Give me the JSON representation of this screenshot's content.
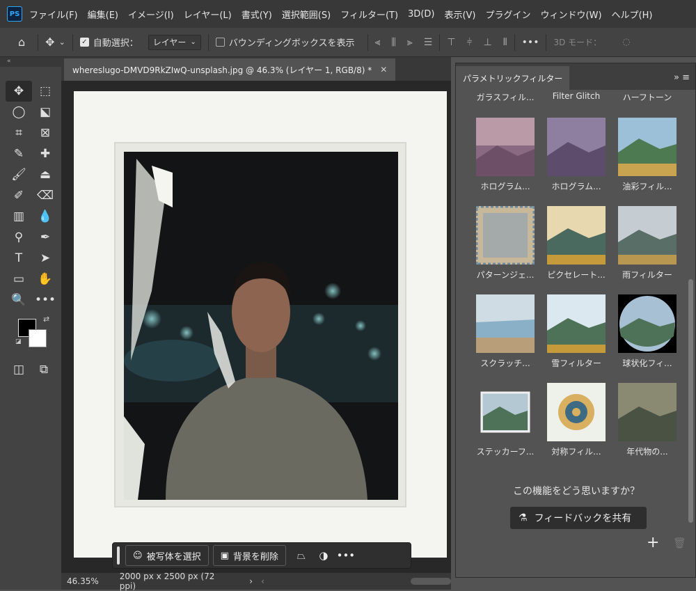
{
  "menubar": {
    "app_icon": "PS",
    "items": [
      "ファイル(F)",
      "編集(E)",
      "イメージ(I)",
      "レイヤー(L)",
      "書式(Y)",
      "選択範囲(S)",
      "フィルター(T)",
      "3D(D)",
      "表示(V)",
      "プラグイン",
      "ウィンドウ(W)",
      "ヘルプ(H)"
    ]
  },
  "options": {
    "auto_select_label": "自動選択：",
    "layer_select_value": "レイヤー",
    "bounding_box_label": "バウンディングボックスを表示",
    "mode_3d_label": "3D モード："
  },
  "document": {
    "tab_title": "whereslugo-DMVD9RkZIwQ-unsplash.jpg @ 46.3% (レイヤー 1, RGB/8) *",
    "zoom": "46.35%",
    "dimensions": "2000 px x 2500 px (72 ppi)"
  },
  "context_bar": {
    "select_subject": "被写体を選択",
    "remove_bg": "背景を削除"
  },
  "panel": {
    "title": "パラメトリックフィルター",
    "top_labels": [
      "ガラスフィル...",
      "Filter Glitch",
      "ハーフトーン"
    ],
    "filters": [
      {
        "label": "ホログラム..."
      },
      {
        "label": "ホログラム..."
      },
      {
        "label": "油彩フィル..."
      },
      {
        "label": "パターンジェ..."
      },
      {
        "label": "ピクセレート..."
      },
      {
        "label": "雨フィルター"
      },
      {
        "label": "スクラッチ..."
      },
      {
        "label": "雪フィルター"
      },
      {
        "label": "球状化フィ..."
      },
      {
        "label": "ステッカーフ..."
      },
      {
        "label": "対称フィル..."
      },
      {
        "label": "年代物の..."
      }
    ],
    "question": "この機能をどう思いますか？",
    "feedback_button": "フィードバックを共有"
  }
}
